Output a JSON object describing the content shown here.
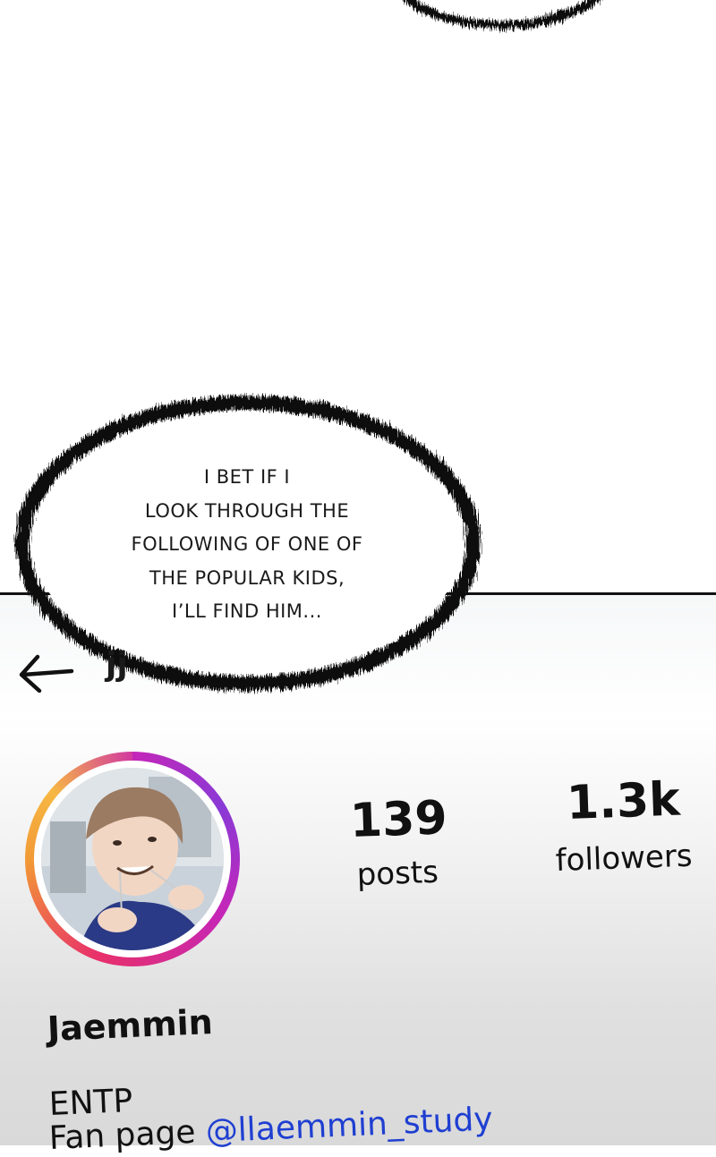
{
  "speech_bubble": {
    "lines": [
      "I BET IF I",
      "LOOK THROUGH THE",
      "FOLLOWING OF ONE OF",
      "THE POPULAR KIDS,",
      "I’LL FIND HIM..."
    ]
  },
  "header": {
    "back_icon": "arrow-left-icon",
    "username_partial": "jj"
  },
  "profile": {
    "avatar_icon": "profile-photo",
    "ring_colors": [
      "#c426b8",
      "#e8306a",
      "#f29a35",
      "#f6b844"
    ],
    "posts_count": "139",
    "posts_label": "posts",
    "followers_count": "1.3k",
    "followers_label": "followers",
    "name": "Jaemmin",
    "bio_line1": "ENTP",
    "bio_line2_prefix": "Fan page",
    "bio_handle": "@llaemmin_study",
    "handle_color": "#1f3fd1"
  }
}
